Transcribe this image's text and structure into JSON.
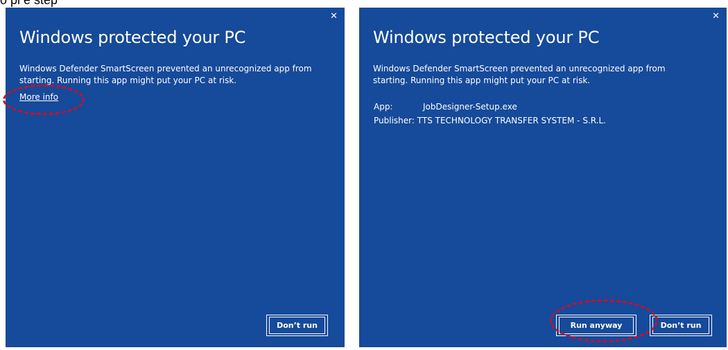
{
  "header_fragment": "o   pl   e  step",
  "left_dialog": {
    "title": "Windows protected your PC",
    "message": "Windows Defender SmartScreen prevented an unrecognized app from starting. Running this app might put your PC at risk.",
    "more_info_link": "More info",
    "close_icon": "✕",
    "dont_run_label": "Don’t run"
  },
  "right_dialog": {
    "title": "Windows protected your PC",
    "message": "Windows Defender SmartScreen prevented an unrecognized app from starting. Running this app might put your PC at risk.",
    "details": [
      {
        "label": "App:",
        "value": "JobDesigner-Setup.exe"
      },
      {
        "label": "Publisher:",
        "value": "TTS TECHNOLOGY TRANSFER SYSTEM - S.R.L."
      }
    ],
    "close_icon": "✕",
    "run_anyway_label": "Run anyway",
    "dont_run_label": "Don’t run"
  },
  "colors": {
    "dialog_background": "#164a9a",
    "text": "#ffffff",
    "annotation": "#c8102e"
  }
}
